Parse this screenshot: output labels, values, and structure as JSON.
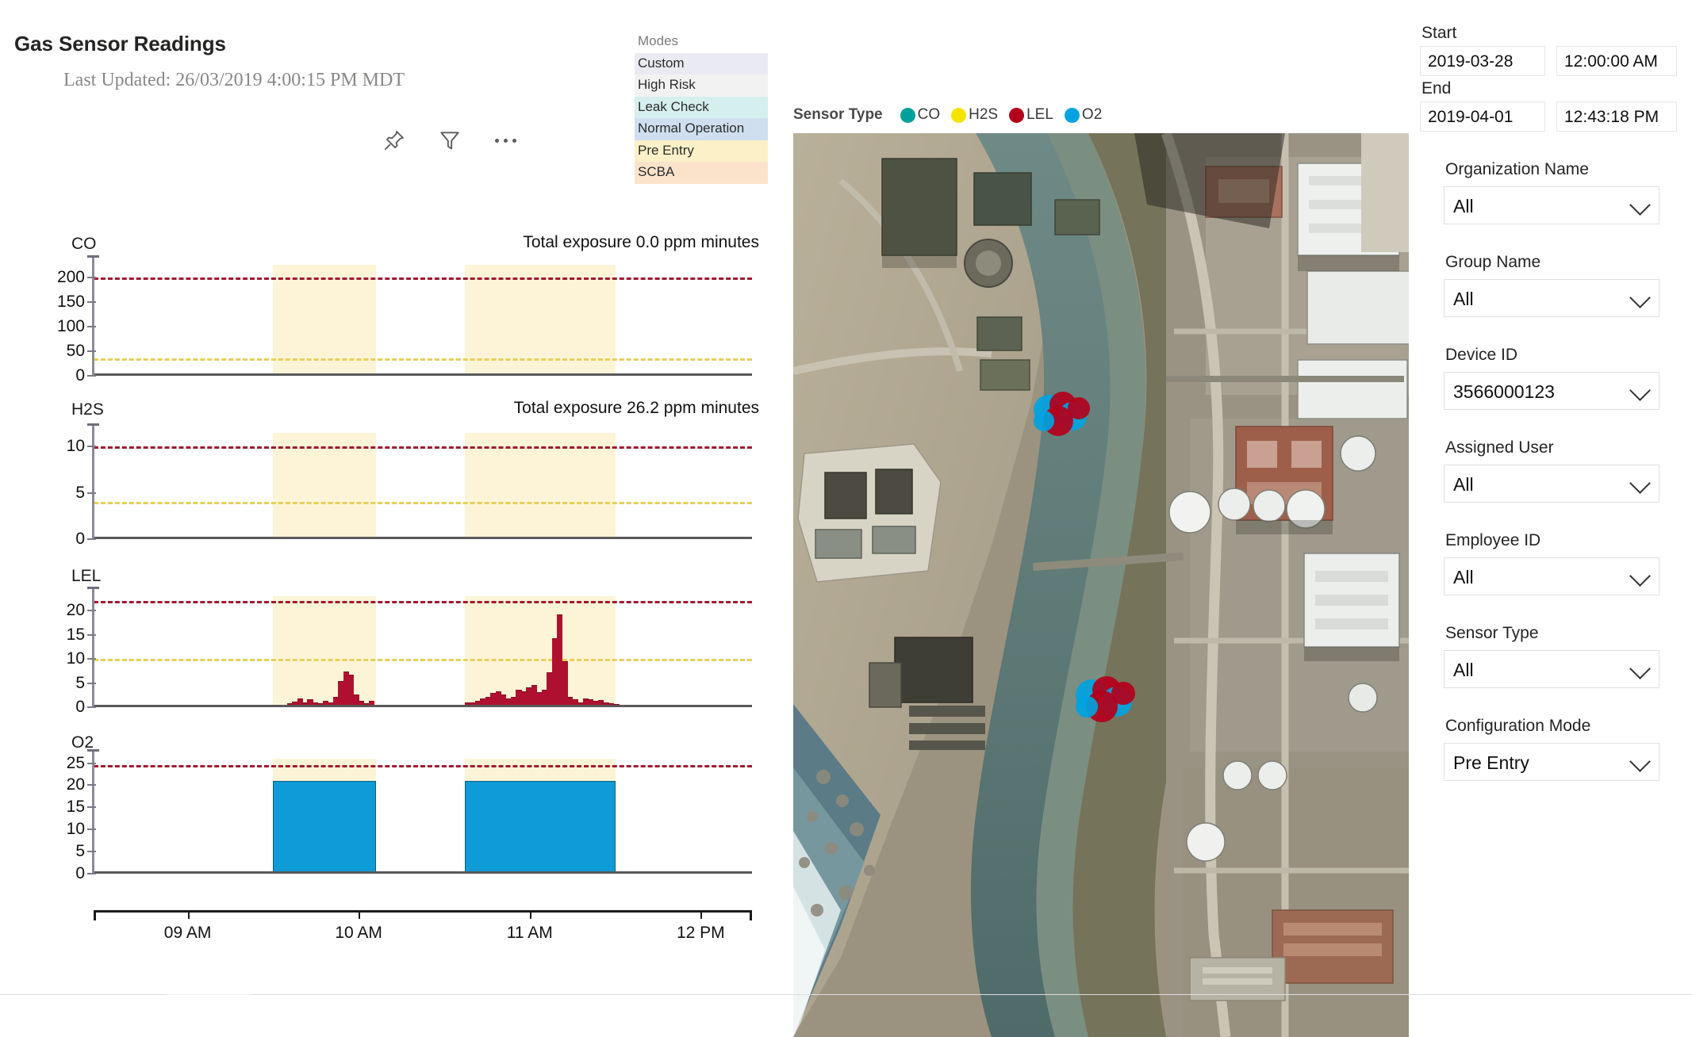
{
  "header": {
    "title": "Gas Sensor Readings",
    "last_updated": "Last Updated: 26/03/2019 4:00:15 PM MDT",
    "actions": [
      {
        "name": "pin-icon",
        "label": "Pin"
      },
      {
        "name": "filter-icon",
        "label": "Filter"
      },
      {
        "name": "more-options-icon",
        "label": "More options"
      }
    ]
  },
  "modes_legend": {
    "title": "Modes",
    "items": [
      {
        "label": "Custom",
        "color": "#eaeaf3"
      },
      {
        "label": "High Risk",
        "color": "#f2f2f2"
      },
      {
        "label": "Leak Check",
        "color": "#d5eeee"
      },
      {
        "label": "Normal Operation",
        "color": "#cfdff0"
      },
      {
        "label": "Pre Entry",
        "color": "#fcf0c8"
      },
      {
        "label": "SCBA",
        "color": "#fbe3cb"
      }
    ]
  },
  "sensor_legend": {
    "title": "Sensor Type",
    "items": [
      {
        "label": "CO",
        "color": "#00a19a"
      },
      {
        "label": "H2S",
        "color": "#f5e400"
      },
      {
        "label": "LEL",
        "color": "#b3001b"
      },
      {
        "label": "O2",
        "color": "#00a3e0"
      }
    ]
  },
  "filters": {
    "start_label": "Start",
    "start_date": "2019-03-28",
    "start_time": "12:00:00 AM",
    "end_label": "End",
    "end_date": "2019-04-01",
    "end_time": "12:43:18 PM",
    "dropdowns": [
      {
        "label": "Organization Name",
        "value": "All"
      },
      {
        "label": "Group Name",
        "value": "All"
      },
      {
        "label": "Device ID",
        "value": "3566000123"
      },
      {
        "label": "Assigned User",
        "value": "All"
      },
      {
        "label": "Employee ID",
        "value": "All"
      },
      {
        "label": "Sensor Type",
        "value": "All"
      },
      {
        "label": "Configuration Mode",
        "value": "Pre Entry"
      }
    ]
  },
  "chart_data": [
    {
      "type": "area",
      "title": "CO",
      "annotation": "Total exposure 0.0 ppm minutes",
      "ylabel": "CO",
      "yticks": [
        0,
        50,
        100,
        150,
        200
      ],
      "ylim": [
        0,
        225
      ],
      "alarm_high": 200,
      "alarm_low": 35,
      "values": [],
      "xlim_hours": [
        8.45,
        12.3
      ],
      "bands": [
        [
          9.5,
          10.1
        ],
        [
          10.62,
          11.5
        ]
      ]
    },
    {
      "type": "area",
      "title": "H2S",
      "annotation": "Total exposure 26.2 ppm minutes",
      "ylabel": "H2S",
      "yticks": [
        0,
        5,
        10
      ],
      "ylim": [
        0,
        11.5
      ],
      "alarm_high": 10,
      "alarm_low": 4,
      "values": [],
      "xlim_hours": [
        8.45,
        12.3
      ],
      "bands": [
        [
          9.5,
          10.1
        ],
        [
          10.62,
          11.5
        ]
      ]
    },
    {
      "type": "area",
      "title": "LEL",
      "annotation": "",
      "ylabel": "LEL",
      "yticks": [
        0,
        5,
        10,
        15,
        20
      ],
      "ylim": [
        0,
        23
      ],
      "alarm_high": 22,
      "alarm_low": 10,
      "xlim_hours": [
        8.45,
        12.3
      ],
      "bands": [
        [
          9.5,
          10.1
        ],
        [
          10.62,
          11.5
        ]
      ],
      "x": [
        9.55,
        9.58,
        9.61,
        9.64,
        9.67,
        9.7,
        9.73,
        9.76,
        9.79,
        9.82,
        9.85,
        9.88,
        9.91,
        9.94,
        9.97,
        10.0,
        10.03,
        10.06,
        10.62,
        10.65,
        10.68,
        10.71,
        10.74,
        10.77,
        10.8,
        10.83,
        10.86,
        10.89,
        10.92,
        10.95,
        10.98,
        11.01,
        11.04,
        11.07,
        11.1,
        11.13,
        11.16,
        11.19,
        11.22,
        11.25,
        11.28,
        11.31,
        11.34,
        11.37,
        11.4,
        11.43,
        11.46,
        11.49
      ],
      "values": [
        0.4,
        0.6,
        1.0,
        1.6,
        0.9,
        1.4,
        0.8,
        0.7,
        1.1,
        0.9,
        2.0,
        5.2,
        7.3,
        6.6,
        2.5,
        1.1,
        0.6,
        1.2,
        0.8,
        0.9,
        1.1,
        1.6,
        2.0,
        2.8,
        3.1,
        2.4,
        1.6,
        2.0,
        3.4,
        3.1,
        4.0,
        4.4,
        3.0,
        3.4,
        7.0,
        14.2,
        19.0,
        9.4,
        2.0,
        1.4,
        0.9,
        1.6,
        1.5,
        1.1,
        1.3,
        0.9,
        0.7,
        0.5
      ]
    },
    {
      "type": "bar",
      "title": "O2",
      "annotation": "",
      "ylabel": "O2",
      "yticks": [
        0,
        5,
        10,
        15,
        20,
        25
      ],
      "ylim": [
        0,
        26
      ],
      "alarm_high": 24.5,
      "xlim_hours": [
        8.45,
        12.3
      ],
      "bands": [
        [
          9.5,
          10.1
        ],
        [
          10.62,
          11.5
        ]
      ],
      "bars": [
        {
          "from": 9.5,
          "to": 10.1,
          "value": 21.0
        },
        {
          "from": 10.62,
          "to": 11.5,
          "value": 21.0
        }
      ]
    }
  ],
  "xaxis": {
    "ticks": [
      "09 AM",
      "10 AM",
      "11 AM",
      "12 PM"
    ],
    "tick_hours": [
      9,
      10,
      11,
      12
    ],
    "range_hours": [
      8.45,
      12.3
    ]
  }
}
